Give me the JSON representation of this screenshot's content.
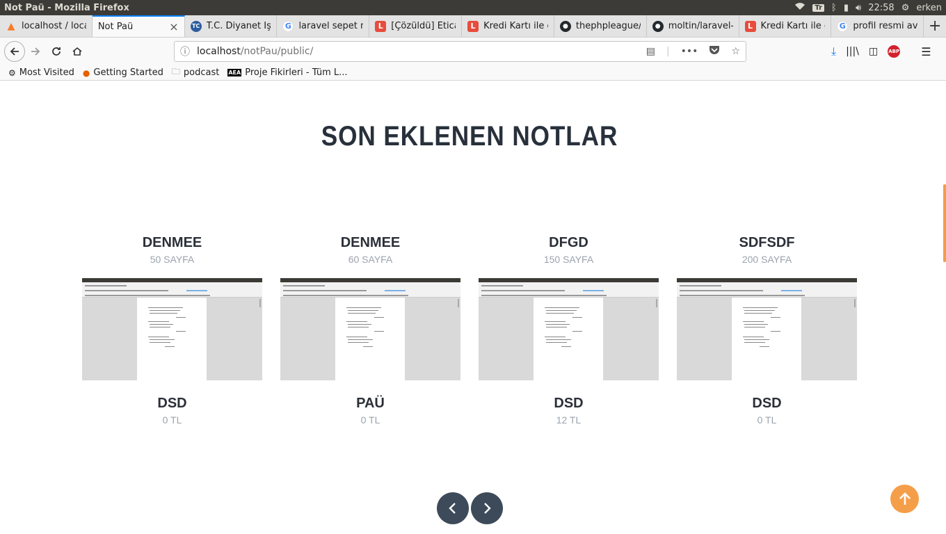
{
  "window": {
    "title": "Not Paü - Mozilla Firefox",
    "tray": {
      "keyboard": "Tr",
      "time": "22:58",
      "user": "erken"
    }
  },
  "tabs": [
    {
      "label": "localhost / loca",
      "icon": "xampp-icon",
      "active": false
    },
    {
      "label": "Not Paü",
      "icon": "",
      "active": true
    },
    {
      "label": "T.C. Diyanet İşle",
      "icon": "diyanet-icon",
      "active": false
    },
    {
      "label": "laravel sepet n",
      "icon": "google-icon",
      "active": false
    },
    {
      "label": "[Çözüldü] Etica",
      "icon": "laravel-icon",
      "active": false
    },
    {
      "label": "Kredi Kartı ile ö",
      "icon": "laravel-icon",
      "active": false
    },
    {
      "label": "thephpleague/c",
      "icon": "github-icon",
      "active": false
    },
    {
      "label": "moltin/laravel-",
      "icon": "github-icon",
      "active": false
    },
    {
      "label": "Kredi Kartı ile ö",
      "icon": "laravel-icon",
      "active": false
    },
    {
      "label": "profil resmi ava",
      "icon": "google-icon",
      "active": false
    }
  ],
  "urlbar": {
    "host": "localhost",
    "path": "/notPau/public/"
  },
  "bookmarks": [
    {
      "label": "Most Visited",
      "icon": "gear-icon"
    },
    {
      "label": "Getting Started",
      "icon": "firefox-icon"
    },
    {
      "label": "podcast",
      "icon": "folder-icon"
    },
    {
      "label": "Proje Fikirleri - Tüm L...",
      "icon": "aea-icon"
    }
  ],
  "page": {
    "heading": "SON EKLENEN NOTLAR",
    "cards": [
      {
        "title": "DENMEE",
        "pages": "50 SAYFA",
        "course": "DSD",
        "price": "0 TL"
      },
      {
        "title": "DENMEE",
        "pages": "60 SAYFA",
        "course": "PAÜ",
        "price": "0 TL"
      },
      {
        "title": "DFGD",
        "pages": "150 SAYFA",
        "course": "DSD",
        "price": "12 TL"
      },
      {
        "title": "SDFSDF",
        "pages": "200 SAYFA",
        "course": "DSD",
        "price": "0 TL"
      }
    ]
  },
  "colors": {
    "accent": "#f59e4a",
    "heading": "#28303b",
    "pager": "#3d4a5a",
    "muted": "#9aa3ae"
  }
}
